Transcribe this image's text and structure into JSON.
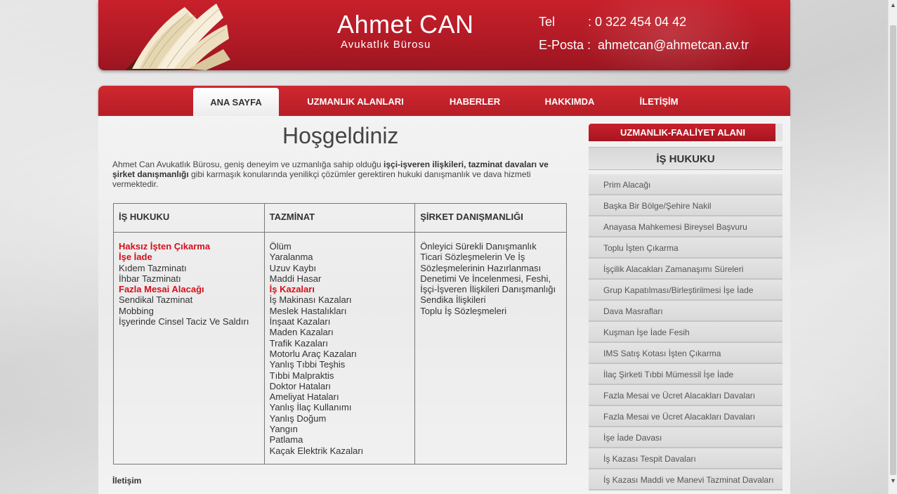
{
  "header": {
    "name": "Ahmet CAN",
    "subtitle": "Avukatlık Bürosu",
    "tel_label": "Tel",
    "tel_value": ": 0 322 454 04 42",
    "email_label": "E-Posta :",
    "email_value": "ahmetcan@ahmetcan.av.tr"
  },
  "nav": {
    "items": [
      "ANA SAYFA",
      "UZMANLIK ALANLARI",
      "HABERLER",
      "HAKKIMDA",
      "İLETİŞİM"
    ],
    "active": "ANA SAYFA"
  },
  "main": {
    "title": "Hoşgeldiniz",
    "intro_part1": "Ahmet Can Avukatlık Bürosu,  geniş deneyim ve uzmanlığa sahip olduğu ",
    "intro_bold": "işçi-işveren ilişkileri, tazminat davaları ve şirket danışmanlığı",
    "intro_part2": " gibi karmaşık konularında yenilikçi çözümler gerektiren hukuki danışmanlık ve dava hizmeti vermektedir.",
    "table": {
      "headers": [
        "İŞ HUKUKU",
        "TAZMİNAT",
        "ŞİRKET DANIŞMANLIĞI"
      ],
      "col1": [
        {
          "text": "Haksız İşten Çıkarma",
          "red": true
        },
        {
          "text": "İşe İade",
          "red": true
        },
        {
          "text": "Kıdem Tazminatı",
          "red": false
        },
        {
          "text": "İhbar Tazminatı",
          "red": false
        },
        {
          "text": "Fazla Mesai Alacağı",
          "red": true
        },
        {
          "text": "Sendikal Tazminat",
          "red": false
        },
        {
          "text": "Mobbing",
          "red": false
        },
        {
          "text": "İşyerinde Cinsel Taciz Ve Saldırı",
          "red": false
        }
      ],
      "col2": [
        {
          "text": "Ölüm",
          "red": false
        },
        {
          "text": "Yaralanma",
          "red": false
        },
        {
          "text": "Uzuv Kaybı",
          "red": false
        },
        {
          "text": "Maddi Hasar",
          "red": false
        },
        {
          "text": "İş Kazaları",
          "red": true
        },
        {
          "text": "İş Makinası Kazaları",
          "red": false
        },
        {
          "text": "Meslek Hastalıkları",
          "red": false
        },
        {
          "text": "İnşaat Kazaları",
          "red": false
        },
        {
          "text": "Maden Kazaları",
          "red": false
        },
        {
          "text": "Trafik Kazaları",
          "red": false
        },
        {
          "text": "Motorlu Araç Kazaları",
          "red": false
        },
        {
          "text": "Yanlış Tıbbi Teşhis",
          "red": false
        },
        {
          "text": "Tıbbi Malpraktis",
          "red": false
        },
        {
          "text": "Doktor Hataları",
          "red": false
        },
        {
          "text": "Ameliyat Hataları",
          "red": false
        },
        {
          "text": "Yanlış İlaç Kullanımı",
          "red": false
        },
        {
          "text": "Yanlış Doğum",
          "red": false
        },
        {
          "text": "Yangın",
          "red": false
        },
        {
          "text": "Patlama",
          "red": false
        },
        {
          "text": "Kaçak Elektrik Kazaları",
          "red": false
        }
      ],
      "col3": [
        {
          "text": "Önleyici Sürekli Danışmanlık",
          "red": false
        },
        {
          "text": "Ticari Sözleşmelerin Ve İş Sözleşmelerinin Hazırlanması",
          "red": false
        },
        {
          "text": "Denetimi Ve İncelenmesi, Feshi, İşçi-İşveren İlişkileri Danışmanlığı",
          "red": false
        },
        {
          "text": "Sendika İlişkileri",
          "red": false
        },
        {
          "text": "Toplu İş Sözleşmeleri",
          "red": false
        }
      ]
    },
    "contact_heading": "İletişim"
  },
  "sidebar": {
    "header": "UZMANLIK-FAALİYET ALANI",
    "subheader": "İŞ HUKUKU",
    "items": [
      "Prim Alacağı",
      "Başka Bir Bölge/Şehire Nakil",
      "Anayasa Mahkemesi Bireysel Başvuru",
      "Toplu İşten Çıkarma",
      "İşçilik Alacakları Zamanaşımı Süreleri",
      "Grup Kapatılması/Birleştirilmesi İşe İade",
      "Dava Masrafları",
      "Kuşman İşe İade Fesih",
      "IMS Satış Kotası İşten Çıkarma",
      "İlaç Şirketi Tıbbi Mümessil İşe İade",
      "Fazla Mesai ve Ücret Alacakları Davaları",
      "Fazla Mesai ve Ücret Alacakları Davaları",
      "İşe İade Davası",
      "İş Kazası Tespit Davaları",
      "İş Kazası Maddi ve Manevi Tazminat Davaları"
    ]
  },
  "colors": {
    "brand_red": "#c8202b",
    "highlight_red": "#d4101c"
  }
}
